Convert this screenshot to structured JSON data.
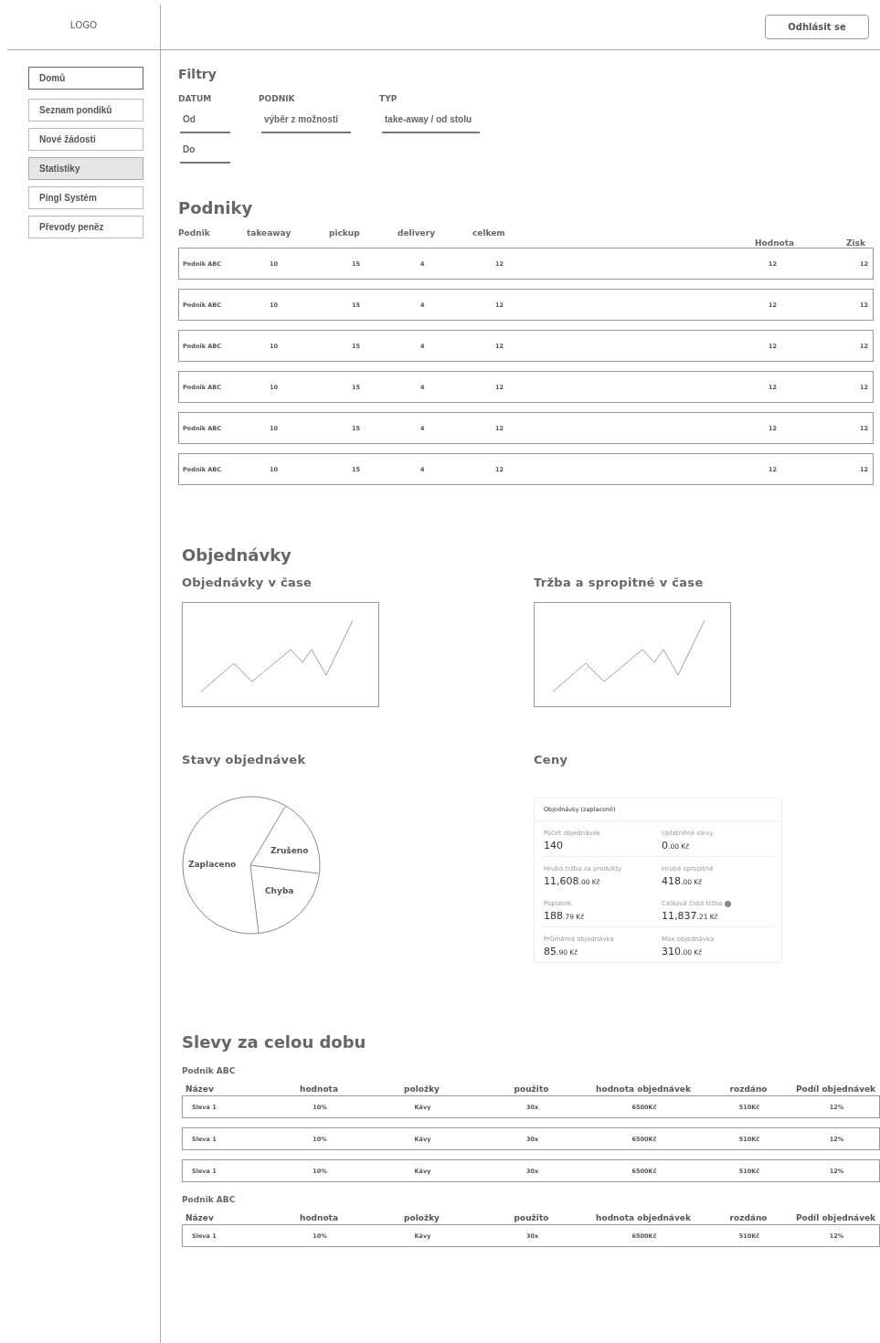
{
  "header": {
    "logo": "LOGO",
    "logout_button": "Odhlásit se"
  },
  "sidebar": {
    "items": [
      {
        "label": "Domů",
        "selected": false,
        "focused": true
      },
      {
        "label": "Seznam pondiků",
        "selected": false,
        "focused": false
      },
      {
        "label": "Nové žádosti",
        "selected": false,
        "focused": false
      },
      {
        "label": "Statistiky",
        "selected": true,
        "focused": false
      },
      {
        "label": "Pingl Systém",
        "selected": false,
        "focused": false
      },
      {
        "label": "Převody peněz",
        "selected": false,
        "focused": false
      }
    ]
  },
  "filters": {
    "title": "Filtry",
    "groups": [
      {
        "label": "DATUM",
        "fields": [
          {
            "placeholder": "Od"
          },
          {
            "placeholder": "Do"
          }
        ]
      },
      {
        "label": "PODNIK",
        "fields": [
          {
            "placeholder": "výběr z možností"
          }
        ]
      },
      {
        "label": "TYP",
        "fields": [
          {
            "placeholder": "take-away / od stolu"
          }
        ]
      }
    ]
  },
  "businesses": {
    "title": "Podniky",
    "columns": [
      "Podnik",
      "takeaway",
      "pickup",
      "delivery",
      "celkem",
      "Hodnota",
      "Zisk"
    ],
    "rows": [
      [
        "Podnik ABC",
        "10",
        "15",
        "4",
        "12",
        "12",
        "12"
      ],
      [
        "Podnik ABC",
        "10",
        "15",
        "4",
        "12",
        "12",
        "12"
      ],
      [
        "Podnik ABC",
        "10",
        "15",
        "4",
        "12",
        "12",
        "12"
      ],
      [
        "Podnik ABC",
        "10",
        "15",
        "4",
        "12",
        "12",
        "12"
      ],
      [
        "Podnik ABC",
        "10",
        "15",
        "4",
        "12",
        "12",
        "12"
      ],
      [
        "Podnik ABC",
        "10",
        "15",
        "4",
        "12",
        "12",
        "12"
      ]
    ]
  },
  "orders": {
    "title": "Objednávky",
    "line_charts": [
      {
        "title": "Objednávky v čase"
      },
      {
        "title": "Tržba a spropitné v čase"
      }
    ],
    "status_chart": {
      "title": "Stavy objednávek",
      "labels": [
        "Zaplaceno",
        "Zrušeno",
        "Chyba"
      ]
    },
    "prices": {
      "title": "Ceny",
      "card_title": "Objednávky (zaplacené)",
      "stats": [
        {
          "label": "Počet objednávek",
          "value": "140",
          "info": false
        },
        {
          "label": "Uplatněné slevy",
          "value": "0",
          "unit": ".00 Kč",
          "info": false
        },
        {
          "label": "Hrubá tržba za produkty",
          "value": "11,608",
          "unit": ".00 Kč",
          "info": false
        },
        {
          "label": "Hrubé spropitné",
          "value": "418",
          "unit": ".00 Kč",
          "info": false
        },
        {
          "label": "Poplatek",
          "value": "188",
          "unit": ".79 Kč",
          "info": false
        },
        {
          "label": "Celková čistá tržba",
          "value": "11,837",
          "unit": ".21 Kč",
          "info": true
        },
        {
          "label": "Průměrná objednávka",
          "value": "85",
          "unit": ".90 Kč",
          "info": false
        },
        {
          "label": "Max objednávka",
          "value": "310",
          "unit": ".00 Kč",
          "info": false
        }
      ]
    }
  },
  "discounts": {
    "title": "Slevy za celou dobu",
    "groups": [
      {
        "business": "Podnik ABC",
        "columns": [
          "Název",
          "hodnota",
          "položky",
          "použito",
          "hodnota objednávek",
          "rozdáno",
          "Podíl objednávek"
        ],
        "rows": [
          [
            "Sleva 1",
            "10%",
            "Kávy",
            "30x",
            "6500Kč",
            "510Kč",
            "12%"
          ],
          [
            "Sleva 1",
            "10%",
            "Kávy",
            "30x",
            "6500Kč",
            "510Kč",
            "12%"
          ],
          [
            "Sleva 1",
            "10%",
            "Kávy",
            "30x",
            "6500Kč",
            "510Kč",
            "12%"
          ]
        ]
      },
      {
        "business": "Podnik ABC",
        "columns": [
          "Název",
          "hodnota",
          "položky",
          "použito",
          "hodnota objednávek",
          "rozdáno",
          "Podíl objednávek"
        ],
        "rows": [
          [
            "Sleva 1",
            "10%",
            "Kávy",
            "30x",
            "6500Kč",
            "510Kč",
            "12%"
          ]
        ]
      }
    ]
  }
}
